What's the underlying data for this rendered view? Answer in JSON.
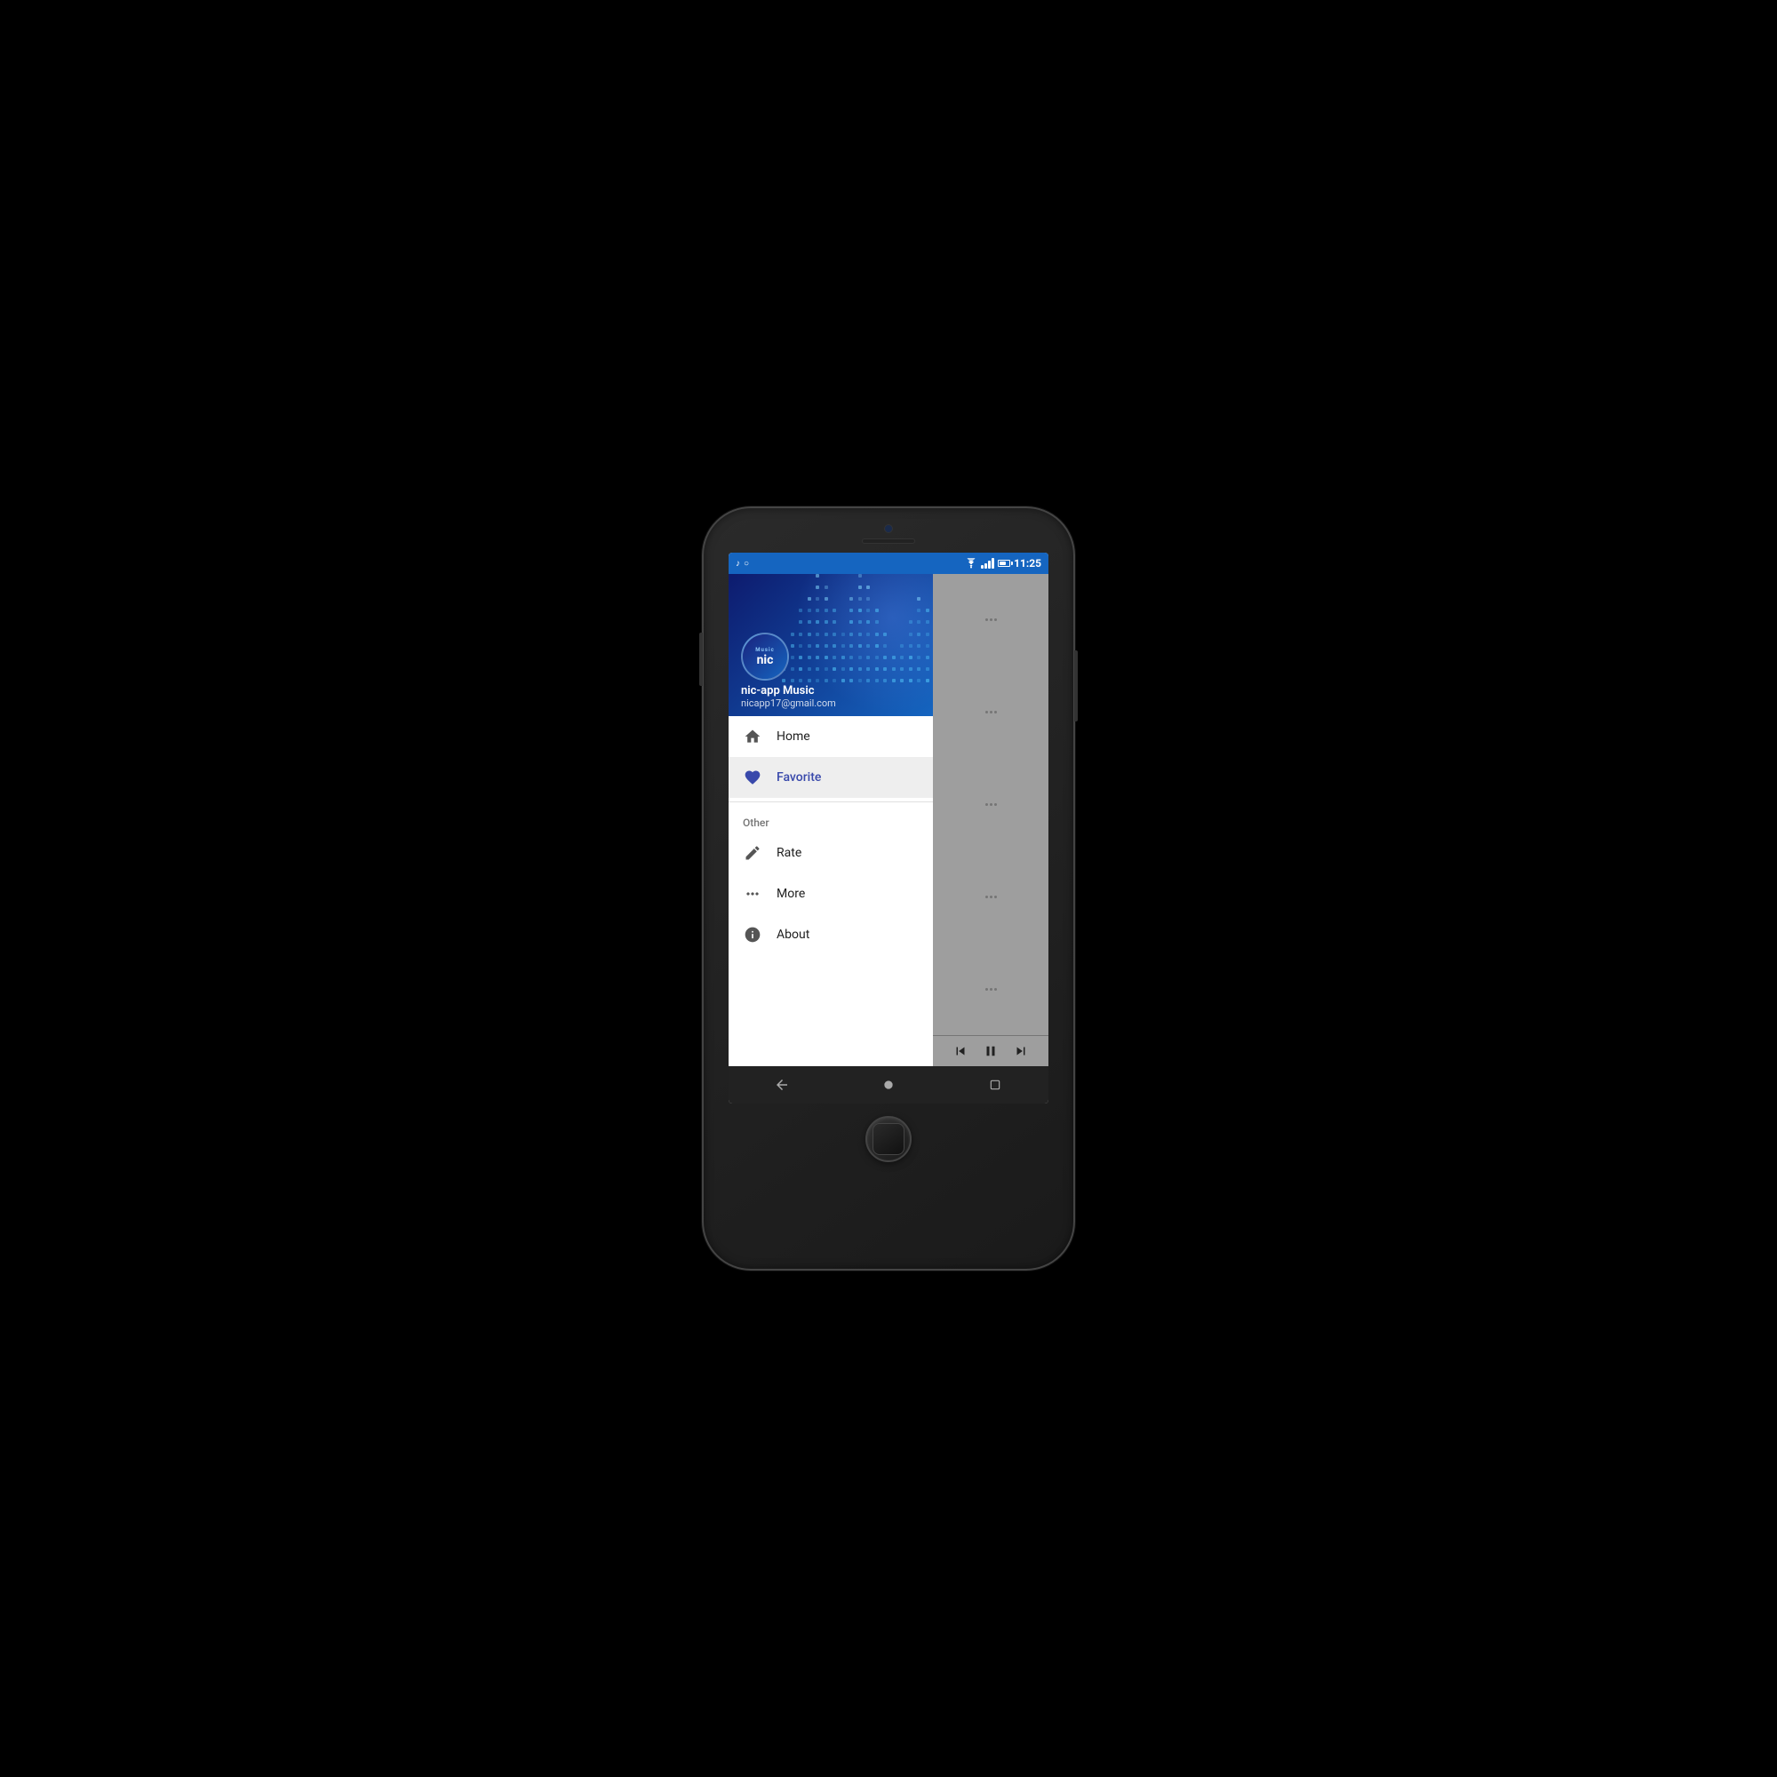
{
  "phone": {
    "status_bar": {
      "time": "11:25",
      "notification_icons": [
        "music-note",
        "circle"
      ]
    },
    "drawer": {
      "user": {
        "name": "nic-app Music",
        "email": "nicapp17@gmail.com",
        "avatar_small": "Music",
        "avatar_main": "nic"
      },
      "menu_items": [
        {
          "id": "home",
          "label": "Home",
          "icon": "home",
          "active": false
        },
        {
          "id": "favorite",
          "label": "Favorite",
          "icon": "heart",
          "active": true
        }
      ],
      "section_header": "Other",
      "other_items": [
        {
          "id": "rate",
          "label": "Rate",
          "icon": "star-edit"
        },
        {
          "id": "more",
          "label": "More",
          "icon": "more-horiz"
        },
        {
          "id": "about",
          "label": "About",
          "icon": "info"
        }
      ]
    },
    "player": {
      "controls": {
        "prev": "⏮",
        "pause": "⏸",
        "next": "⏭"
      }
    },
    "bottom_nav": {
      "back": "◀",
      "home": "●",
      "recent": "■"
    }
  }
}
